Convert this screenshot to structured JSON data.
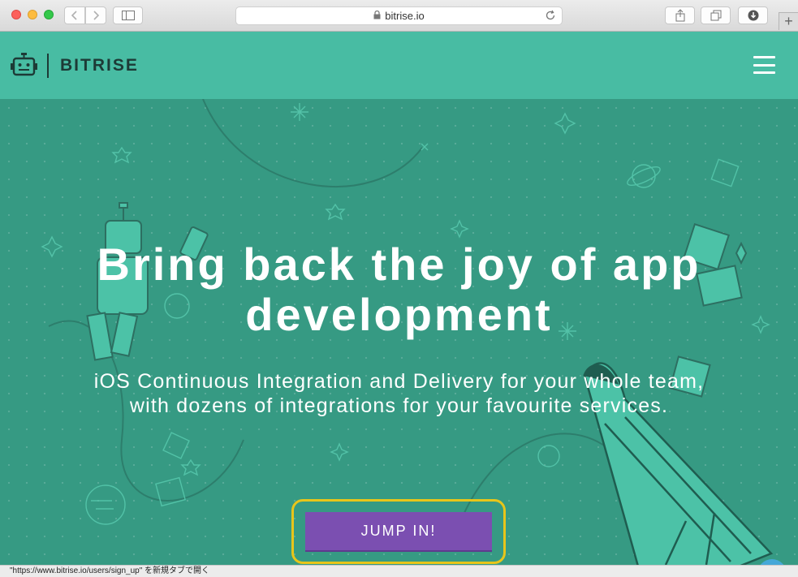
{
  "browser": {
    "url": "bitrise.io",
    "status_text": "\"https://www.bitrise.io/users/sign_up\" を新規タブで開く"
  },
  "site": {
    "brand": "BITRISE",
    "hero": {
      "title_line1": "Bring back the joy of app",
      "title_line2": "development",
      "subtitle_line1": "iOS Continuous Integration and Delivery for your whole team,",
      "subtitle_line2": "with dozens of integrations for your favourite services.",
      "cta_label": "JUMP IN!"
    },
    "help_label": "?"
  },
  "colors": {
    "nav_bg": "#48bca3",
    "hero_bg": "#369a83",
    "cta_bg": "#7b4fb1",
    "highlight": "#e8c51a",
    "help_bg": "#45a8d8"
  }
}
